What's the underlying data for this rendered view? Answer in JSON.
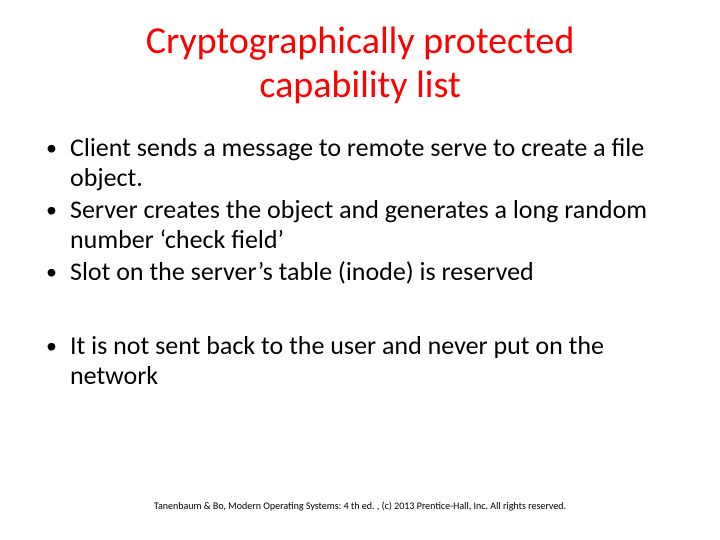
{
  "title": "Cryptographically protected capability list",
  "bullets_a": [
    "Client sends a message to remote serve to create a file object.",
    "Server creates  the object and generates a long random number ‘check field’",
    "Slot on the server’s table (inode) is reserved"
  ],
  "bullets_b": [
    "It is not sent back to the user and never put on the network"
  ],
  "footer": "Tanenbaum & Bo, Modern  Operating Systems: 4 th ed. , (c) 2013 Prentice-Hall, Inc. All rights reserved."
}
